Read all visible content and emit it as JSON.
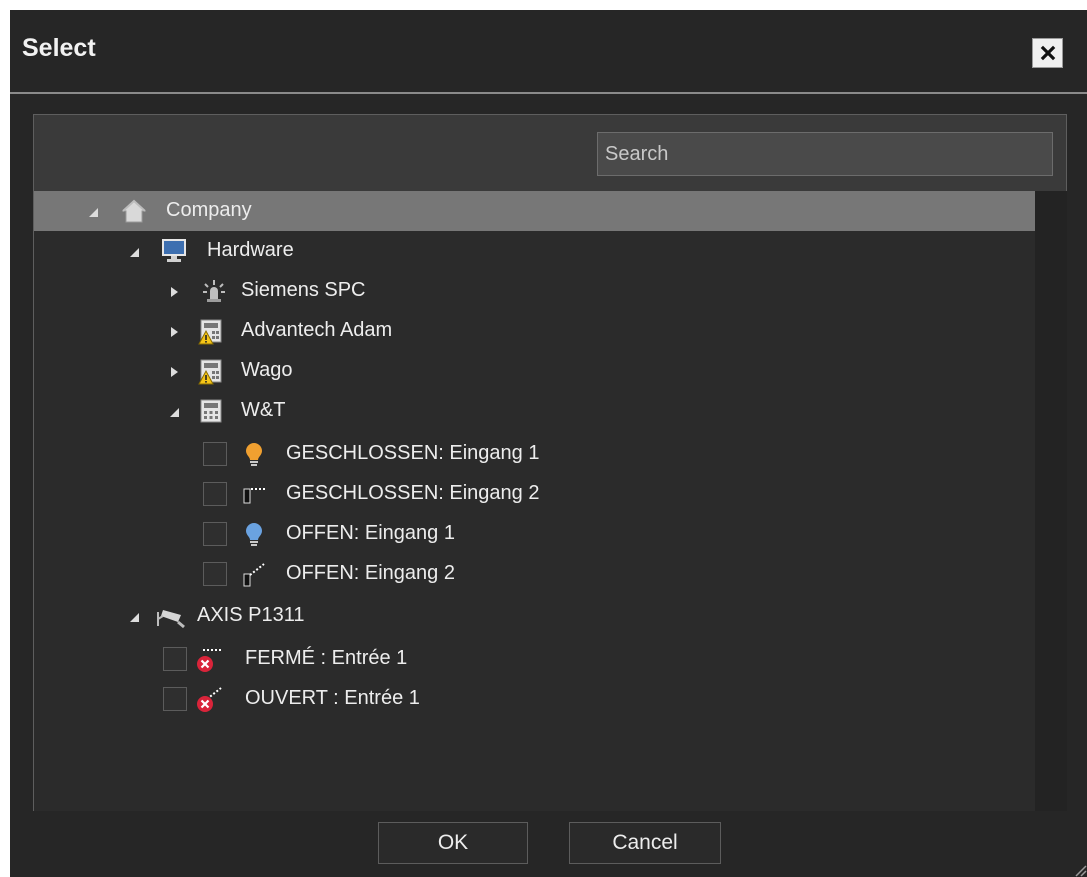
{
  "dialog": {
    "title": "Select",
    "close_icon": "close-x-icon"
  },
  "search": {
    "placeholder": "Search",
    "value": ""
  },
  "tree": {
    "company": {
      "label": "Company",
      "icon": "home-icon",
      "expanded": true
    },
    "hardware": {
      "label": "Hardware",
      "icon": "monitor-icon",
      "expanded": true
    },
    "siemens": {
      "label": "Siemens SPC",
      "icon": "alarm-light-icon",
      "expanded": false
    },
    "advantech": {
      "label": "Advantech Adam",
      "icon": "io-module-warning-icon",
      "expanded": false
    },
    "wago": {
      "label": "Wago",
      "icon": "io-module-warning-icon",
      "expanded": false
    },
    "wt": {
      "label": "W&T",
      "icon": "io-module-icon",
      "expanded": true
    },
    "wt_children": [
      {
        "label": "GESCHLOSSEN: Eingang 1",
        "icon": "bulb-orange-icon",
        "checked": false
      },
      {
        "label": "GESCHLOSSEN: Eingang 2",
        "icon": "input-closed-icon",
        "checked": false
      },
      {
        "label": "OFFEN: Eingang 1",
        "icon": "bulb-blue-icon",
        "checked": false
      },
      {
        "label": "OFFEN: Eingang 2",
        "icon": "input-open-icon",
        "checked": false
      }
    ],
    "axis": {
      "label": "AXIS P1311",
      "icon": "camera-icon",
      "expanded": true
    },
    "axis_children": [
      {
        "label": "FERMÉ : Entrée 1",
        "icon": "input-error-icon",
        "checked": false
      },
      {
        "label": "OUVERT : Entrée 1",
        "icon": "input-error-icon",
        "checked": false
      }
    ]
  },
  "buttons": {
    "ok": "OK",
    "cancel": "Cancel"
  },
  "colors": {
    "background": "#262626",
    "panel": "#3a3a3a",
    "selected_row": "#777777",
    "text": "#ededed"
  }
}
